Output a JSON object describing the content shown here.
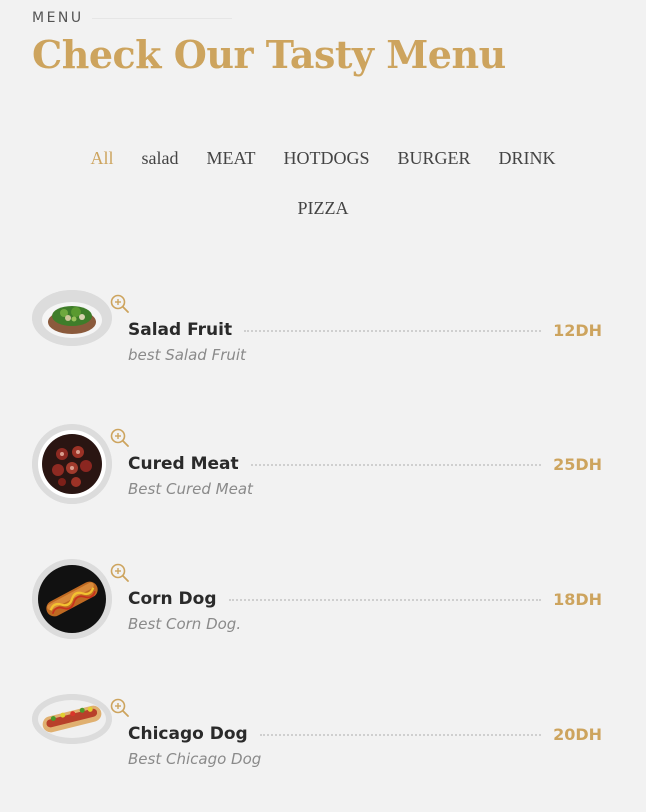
{
  "header": {
    "section_label": "MENU",
    "title": "Check Our Tasty Menu"
  },
  "filters": [
    {
      "label": "All",
      "active": true
    },
    {
      "label": "salad",
      "active": false
    },
    {
      "label": "MEAT",
      "active": false
    },
    {
      "label": "HOTDOGS",
      "active": false
    },
    {
      "label": "BURGER",
      "active": false
    },
    {
      "label": "DRINK",
      "active": false
    },
    {
      "label": "PIZZA",
      "active": false
    }
  ],
  "items": [
    {
      "name": "Salad Fruit",
      "description": "best Salad Fruit",
      "price": "12DH",
      "image": "salad-bowl",
      "zoom_icon": "zoom-in-icon"
    },
    {
      "name": "Cured Meat",
      "description": "Best Cured Meat",
      "price": "25DH",
      "image": "cured-meat-plate",
      "zoom_icon": "zoom-in-icon"
    },
    {
      "name": "Corn Dog",
      "description": "Best Corn Dog.",
      "price": "18DH",
      "image": "corn-dog",
      "zoom_icon": "zoom-in-icon"
    },
    {
      "name": "Chicago Dog",
      "description": "Best Chicago Dog",
      "price": "20DH",
      "image": "chicago-hotdog",
      "zoom_icon": "zoom-in-icon"
    }
  ],
  "colors": {
    "accent": "#cda45e",
    "background": "#f2f2f2",
    "text": "#2a2a2a",
    "muted": "#8a8a8a"
  }
}
